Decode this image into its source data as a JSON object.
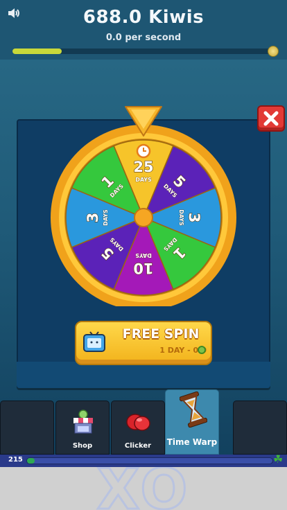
{
  "header": {
    "kiwis": "688.0 Kiwis",
    "per_second": "0.0 per second",
    "progress": 0.19
  },
  "wheel": {
    "slices": [
      {
        "value": "25",
        "unit": "DAYS",
        "color": "#f6c42a"
      },
      {
        "value": "5",
        "unit": "DAYS",
        "color": "#5b22b8"
      },
      {
        "value": "3",
        "unit": "DAYS",
        "color": "#2a98dd"
      },
      {
        "value": "1",
        "unit": "DAYS",
        "color": "#35c83d"
      },
      {
        "value": "10",
        "unit": "DAYS",
        "color": "#a419b8"
      },
      {
        "value": "5",
        "unit": "DAYS",
        "color": "#5b22b8"
      },
      {
        "value": "3",
        "unit": "DAYS",
        "color": "#2a98dd"
      },
      {
        "value": "1",
        "unit": "DAYS",
        "color": "#35c83d"
      }
    ]
  },
  "spin_button": {
    "label": "FREE SPIN",
    "cost": "1 DAY - 0.0"
  },
  "nav": {
    "tabs": [
      {
        "label": "",
        "icon": "blank"
      },
      {
        "label": "Shop",
        "icon": "shop-stall-icon"
      },
      {
        "label": "Clicker",
        "icon": "boxing-glove-icon"
      },
      {
        "label": "Time Warp",
        "icon": "hourglass-icon",
        "active": true
      },
      {
        "label": "",
        "icon": "blank"
      }
    ]
  },
  "level": {
    "number": "215",
    "progress": 0.03
  },
  "background_text": "XO"
}
